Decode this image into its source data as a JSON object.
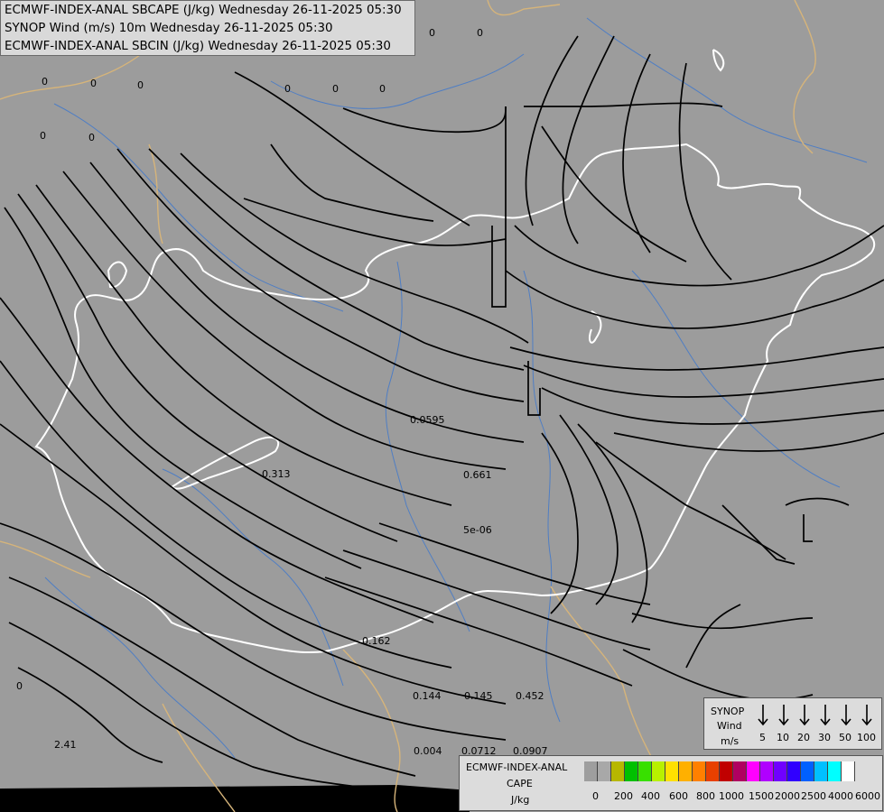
{
  "header": {
    "line1": "ECMWF-INDEX-ANAL SBCAPE (J/kg) Wednesday 26-11-2025 05:30",
    "line2": "SYNOP Wind (m/s) 10m Wednesday 26-11-2025 05:30",
    "line3": "ECMWF-INDEX-ANAL SBCIN (J/kg) Wednesday 26-11-2025 05:30"
  },
  "labels": [
    "0",
    "0",
    "0",
    "0",
    "0",
    "0",
    "0",
    "0",
    "0",
    "0",
    "0",
    "0.0595",
    "0.313",
    "0.661",
    "5e-06",
    "0.162",
    "0.144",
    "0.145",
    "0.452",
    "2.41",
    "0.004",
    "0.0712",
    "0.0907"
  ],
  "synop_legend": {
    "title": "SYNOP",
    "subtitle": "Wind",
    "units": "m/s",
    "speeds": [
      "5",
      "10",
      "20",
      "30",
      "50",
      "100"
    ]
  },
  "cape_legend": {
    "title": "ECMWF-INDEX-ANAL",
    "subtitle": "CAPE",
    "units": "J/kg",
    "ticks": [
      "0",
      "200",
      "400",
      "600",
      "800",
      "1000",
      "1500",
      "2000",
      "2500",
      "4000",
      "6000"
    ],
    "colors": [
      "#9e9e9e",
      "#a8a8a8",
      "#b7b700",
      "#00c000",
      "#38e000",
      "#b8f000",
      "#ffe000",
      "#ffb000",
      "#ff8000",
      "#e84000",
      "#c00000",
      "#b00060",
      "#ff00ff",
      "#b000ff",
      "#7000ff",
      "#3000ff",
      "#0060ff",
      "#00c0ff",
      "#00ffff",
      "#ffffff"
    ]
  },
  "colors": {
    "background": "#9c9c9c",
    "streamline": "#000000",
    "border_white": "#ffffff",
    "border_tan": "#d6b47a",
    "river": "#4f7ec4"
  }
}
